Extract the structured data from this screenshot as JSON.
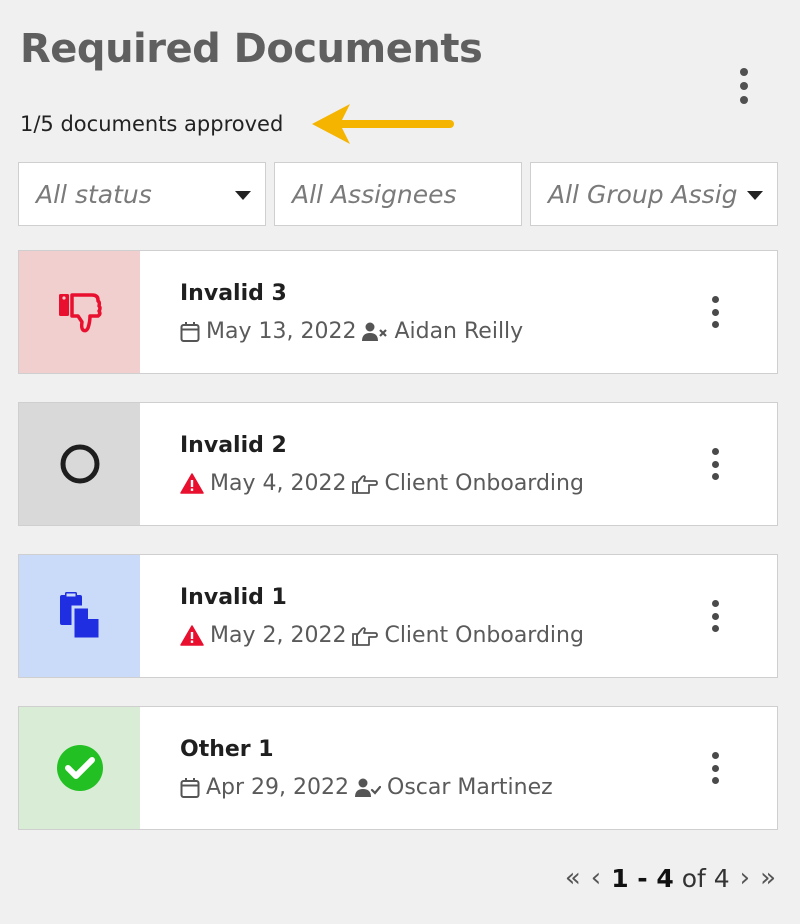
{
  "header": {
    "title": "Required Documents",
    "summary": "1/5 documents approved"
  },
  "filters": {
    "status": "All status",
    "assignees": "All Assignees",
    "group": "All Group Assig"
  },
  "documents": [
    {
      "name": "Invalid 3",
      "date": "May 13, 2022",
      "assignee": "Aidan Reilly",
      "status_icon": "thumbs-down-icon",
      "date_icon": "calendar-icon",
      "assignee_icon": "user-removed-icon",
      "side_color": "#f2cfcf"
    },
    {
      "name": "Invalid 2",
      "date": "May 4, 2022",
      "assignee": "Client Onboarding",
      "status_icon": "empty-circle-icon",
      "date_icon": "warning-icon",
      "assignee_icon": "pointing-hand-icon",
      "side_color": "#d9d9d9"
    },
    {
      "name": "Invalid 1",
      "date": "May 2, 2022",
      "assignee": "Client Onboarding",
      "status_icon": "copy-document-icon",
      "date_icon": "warning-icon",
      "assignee_icon": "pointing-hand-icon",
      "side_color": "#c9dbf8"
    },
    {
      "name": "Other 1",
      "date": "Apr 29, 2022",
      "assignee": "Oscar Martinez",
      "status_icon": "check-circle-icon",
      "date_icon": "calendar-icon",
      "assignee_icon": "user-check-icon",
      "side_color": "#d9ecd6"
    }
  ],
  "pagination": {
    "first": "«",
    "prev": "‹",
    "range": "1 - 4",
    "of": "of 4",
    "next": "›",
    "last": "»"
  },
  "colors": {
    "accent_arrow": "#f5b400",
    "invalid_red": "#e8102e",
    "copy_blue": "#1f2ee0",
    "approved_green": "#22c022"
  }
}
